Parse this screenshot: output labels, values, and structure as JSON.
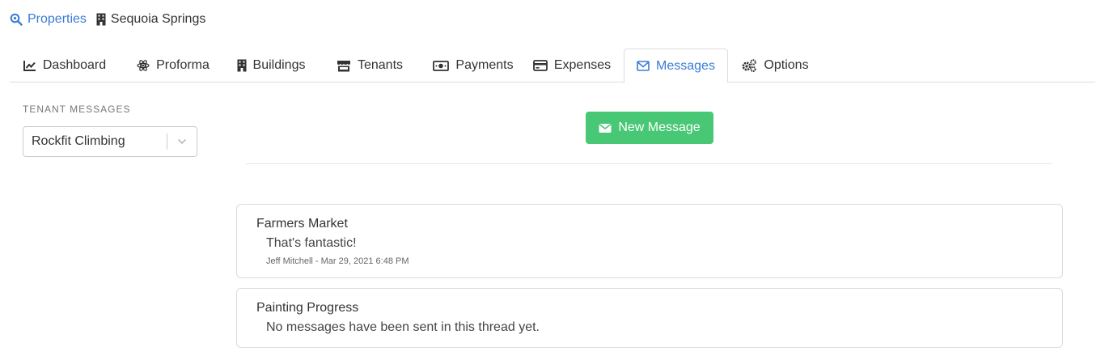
{
  "breadcrumb": {
    "link_label": "Properties",
    "current_label": "Sequoia Springs",
    "link_icon": "search-icon",
    "current_icon": "building-icon"
  },
  "tabs": [
    {
      "label": "Dashboard",
      "icon": "chart-line-icon"
    },
    {
      "label": "Proforma",
      "icon": "atom-icon"
    },
    {
      "label": "Buildings",
      "icon": "building-icon"
    },
    {
      "label": "Tenants",
      "icon": "store-icon"
    },
    {
      "label": "Payments",
      "icon": "money-bill-icon"
    },
    {
      "label": "Expenses",
      "icon": "credit-card-icon"
    },
    {
      "label": "Messages",
      "icon": "envelope-icon",
      "active": true
    },
    {
      "label": "Options",
      "icon": "cogs-icon"
    }
  ],
  "sidebar": {
    "heading": "TENANT MESSAGES",
    "tenant_select": {
      "value": "Rockfit Climbing"
    }
  },
  "actions": {
    "new_message_label": "New Message"
  },
  "threads": [
    {
      "title": "Farmers Market",
      "snippet": "That's fantastic!",
      "meta": "Jeff Mitchell - Mar 29, 2021 6:48 PM"
    },
    {
      "title": "Painting Progress",
      "snippet": "No messages have been sent in this thread yet."
    }
  ],
  "colors": {
    "link": "#3a7bd5",
    "button_green": "#48c774",
    "border": "#dddddd"
  }
}
